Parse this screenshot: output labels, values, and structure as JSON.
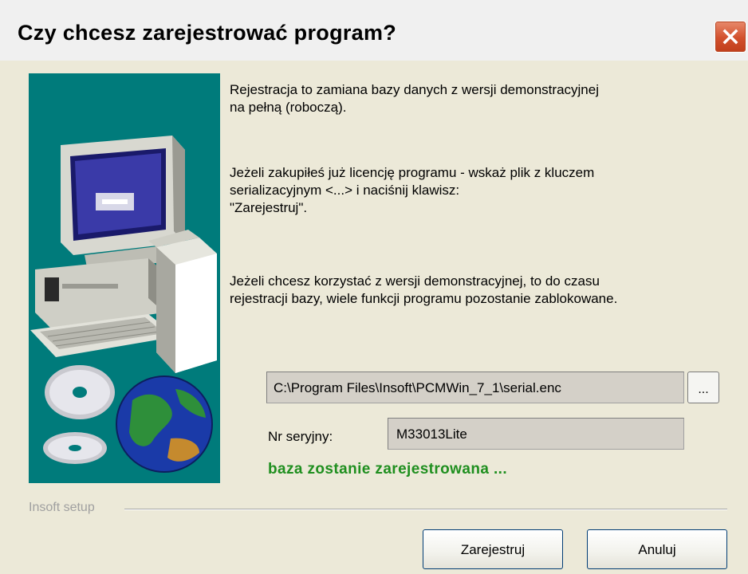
{
  "window": {
    "title": "Czy chcesz zarejestrować program?"
  },
  "messages": {
    "p1": "Rejestracja to zamiana bazy danych z wersji demonstracyjnej\nna pełną (roboczą).",
    "p2": "Jeżeli zakupiłeś już licencję programu - wskaż plik z kluczem\nserializacyjnym <...> i naciśnij klawisz:\n\"Zarejestruj\".",
    "p3": "Jeżeli chcesz korzystać z wersji demonstracyjnej, to do czasu\nrejestracji bazy, wiele funkcji programu pozostanie zablokowane."
  },
  "license_file": {
    "path_value": "C:\\Program Files\\Insoft\\PCMWin_7_1\\serial.enc",
    "browse_label": "..."
  },
  "serial": {
    "label": "Nr seryjny:",
    "value": "M33013Lite"
  },
  "status": {
    "text": "baza zostanie zarejestrowana ...",
    "color": "#1f8f1f"
  },
  "group": {
    "label": "Insoft setup"
  },
  "buttons": {
    "register": "Zarejestruj",
    "cancel": "Anuluj"
  },
  "icons": {
    "close": "close-icon",
    "illustration": "computer-cd-globe-illustration"
  },
  "colors": {
    "illustration_bg": "#007b7b",
    "close_button": "#d2502d",
    "window_bg": "#ece9d8"
  }
}
